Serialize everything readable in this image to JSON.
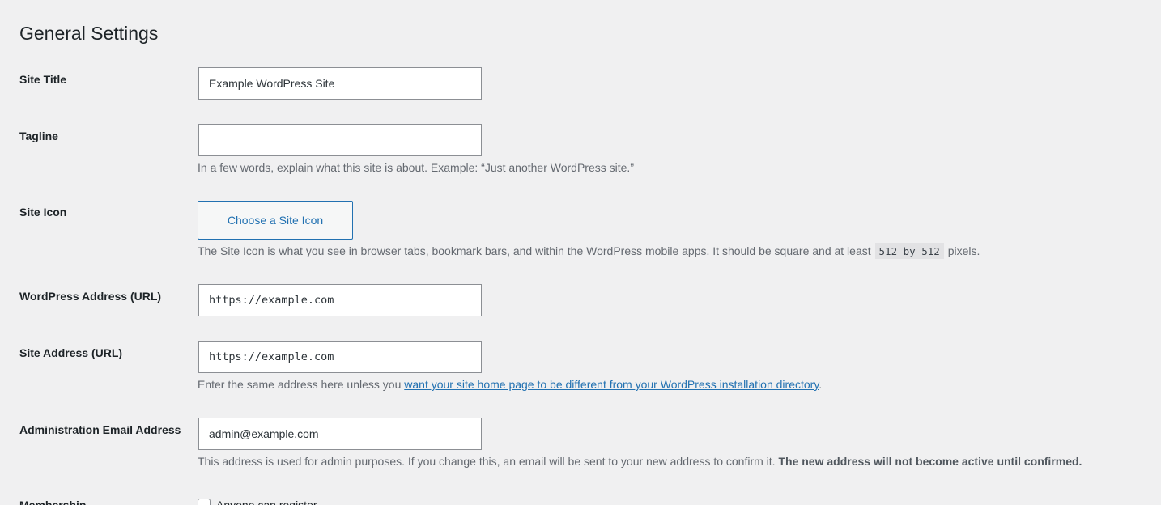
{
  "page": {
    "title": "General Settings"
  },
  "site_title": {
    "label": "Site Title",
    "value": "Example WordPress Site"
  },
  "tagline": {
    "label": "Tagline",
    "value": "",
    "description": "In a few words, explain what this site is about. Example: “Just another WordPress site.”"
  },
  "site_icon": {
    "label": "Site Icon",
    "button_label": "Choose a Site Icon",
    "description_before": "The Site Icon is what you see in browser tabs, bookmark bars, and within the WordPress mobile apps. It should be square and at least",
    "description_code": "512 by 512",
    "description_after": "pixels."
  },
  "wordpress_address": {
    "label": "WordPress Address (URL)",
    "value": "https://example.com"
  },
  "site_address": {
    "label": "Site Address (URL)",
    "value": "https://example.com",
    "description_before": "Enter the same address here unless you",
    "description_link": "want your site home page to be different from your WordPress installation directory",
    "description_after": "."
  },
  "admin_email": {
    "label": "Administration Email Address",
    "value": "admin@example.com",
    "description_before": "This address is used for admin purposes. If you change this, an email will be sent to your new address to confirm it.",
    "description_strong": "The new address will not become active until confirmed."
  },
  "membership": {
    "label": "Membership",
    "checkbox_label": "Anyone can register",
    "checked": false
  },
  "colors": {
    "background": "#f0f0f1",
    "accent": "#2271b1",
    "text": "#1d2327",
    "muted": "#646970"
  }
}
